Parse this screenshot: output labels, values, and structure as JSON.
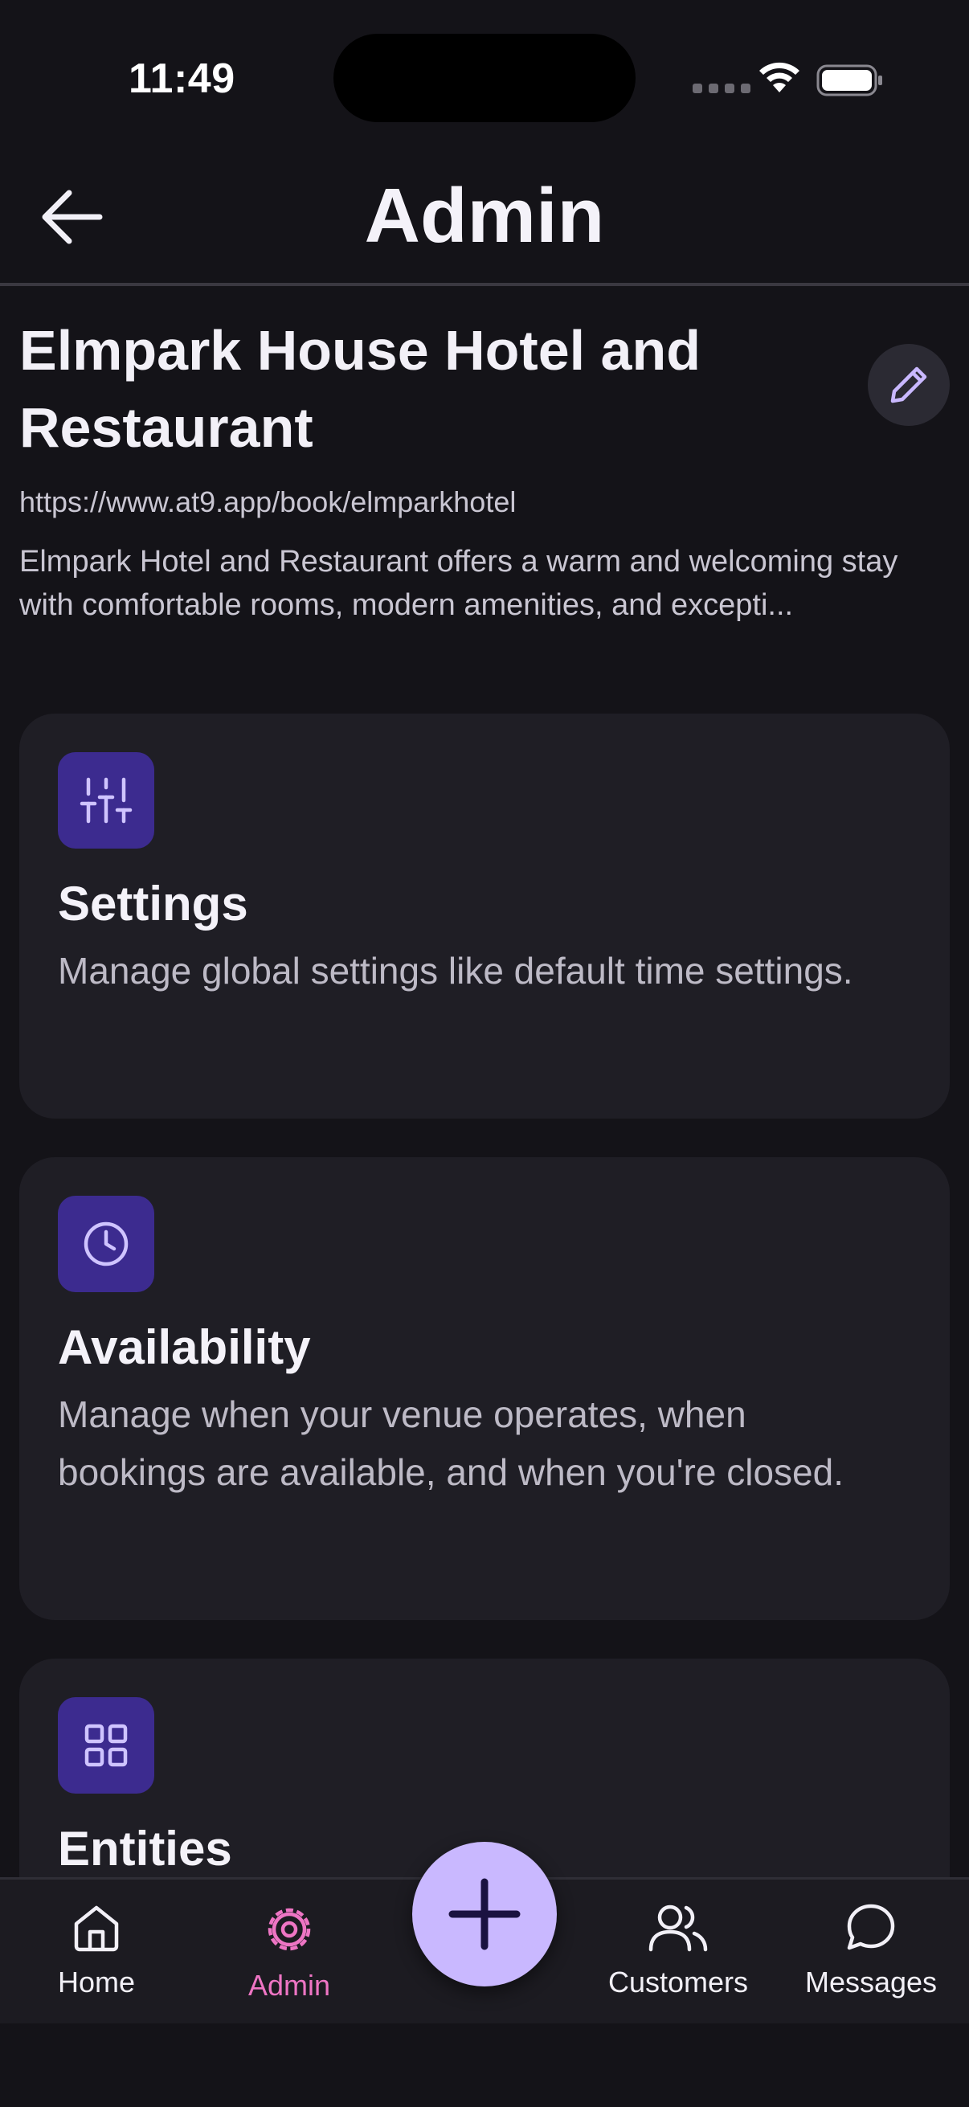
{
  "status_bar": {
    "time": "11:49"
  },
  "header": {
    "title": "Admin"
  },
  "venue": {
    "name": "Elmpark House Hotel and Restaurant",
    "url": "https://www.at9.app/book/elmparkhotel",
    "description": "Elmpark Hotel and Restaurant offers a warm and welcoming stay with comfortable rooms, modern amenities, and excepti..."
  },
  "cards": [
    {
      "title": "Settings",
      "description": "Manage global settings like default time settings.",
      "icon": "sliders-icon"
    },
    {
      "title": "Availability",
      "description": "Manage when your venue operates, when bookings are available, and when you're closed.",
      "icon": "clock-icon"
    },
    {
      "title": "Entities",
      "description": "",
      "icon": "grid-icon"
    }
  ],
  "nav": {
    "items": [
      {
        "label": "Home",
        "icon": "home-icon"
      },
      {
        "label": "Admin",
        "icon": "gear-icon",
        "active": true
      },
      {
        "label": "Customers",
        "icon": "users-icon"
      },
      {
        "label": "Messages",
        "icon": "message-icon"
      }
    ],
    "fab_icon": "plus-icon"
  },
  "colors": {
    "background": "#141318",
    "card": "#1f1e25",
    "icon_tile": "#3c2b8f",
    "accent": "#c9b8ff",
    "active_nav": "#ee75c4"
  }
}
